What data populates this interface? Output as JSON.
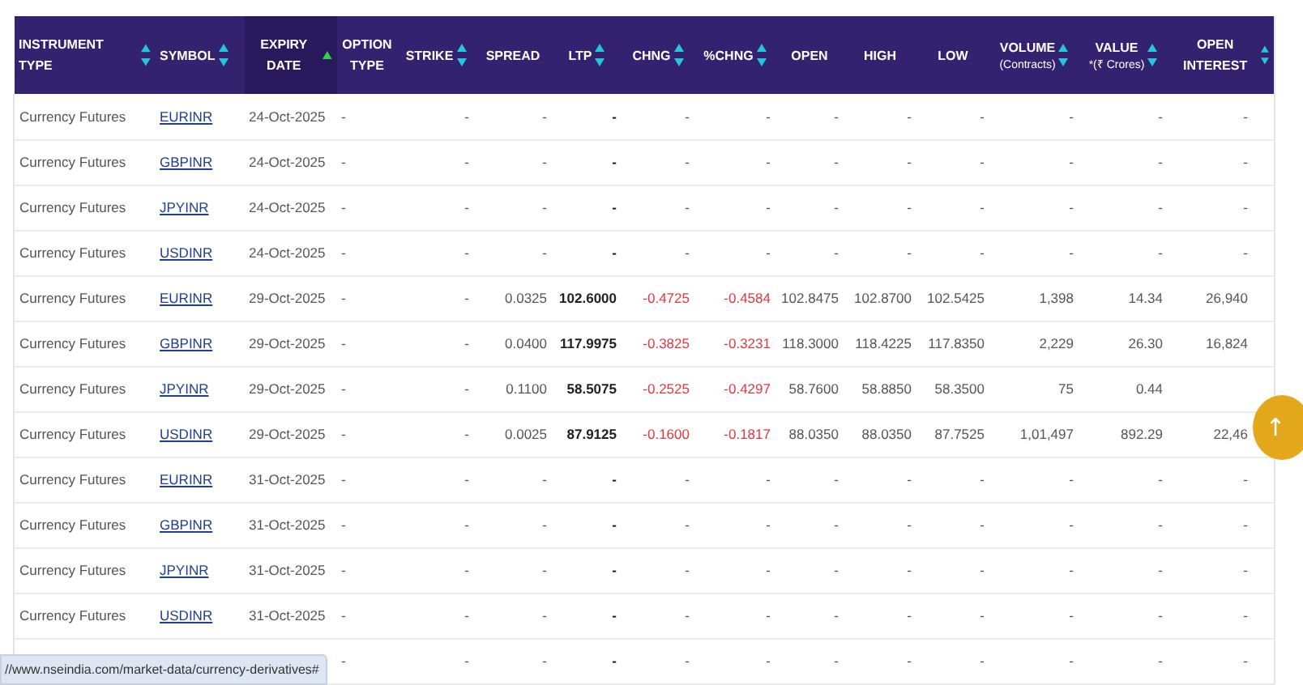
{
  "table": {
    "columns": [
      {
        "label": "INSTRUMENT TYPE",
        "sortable": true,
        "selected": false
      },
      {
        "label": "SYMBOL",
        "sortable": true,
        "selected": false
      },
      {
        "label": "EXPIRY DATE",
        "sortable": true,
        "selected": true
      },
      {
        "label": "OPTION TYPE",
        "sortable": false,
        "selected": false
      },
      {
        "label": "STRIKE",
        "sortable": true,
        "selected": false
      },
      {
        "label": "SPREAD",
        "sortable": false,
        "selected": false
      },
      {
        "label": "LTP",
        "sortable": true,
        "selected": false
      },
      {
        "label": "CHNG",
        "sortable": true,
        "selected": false
      },
      {
        "label": "%CHNG",
        "sortable": true,
        "selected": false
      },
      {
        "label": "OPEN",
        "sortable": false,
        "selected": false
      },
      {
        "label": "HIGH",
        "sortable": false,
        "selected": false
      },
      {
        "label": "LOW",
        "sortable": false,
        "selected": false
      },
      {
        "label": "VOLUME",
        "sublabel": "(Contracts)",
        "sortable": true,
        "selected": false
      },
      {
        "label": "VALUE",
        "sublabel": "*(₹ Crores)",
        "sortable": true,
        "selected": false
      },
      {
        "label": "OPEN INTEREST",
        "sortable": true,
        "selected": false
      }
    ],
    "rows": [
      {
        "cells": [
          "Currency Futures",
          "EURINR",
          "24-Oct-2025",
          "-",
          "-",
          "-",
          "-",
          "-",
          "-",
          "-",
          "-",
          "-",
          "-",
          "-",
          "-"
        ]
      },
      {
        "cells": [
          "Currency Futures",
          "GBPINR",
          "24-Oct-2025",
          "-",
          "-",
          "-",
          "-",
          "-",
          "-",
          "-",
          "-",
          "-",
          "-",
          "-",
          "-"
        ]
      },
      {
        "cells": [
          "Currency Futures",
          "JPYINR",
          "24-Oct-2025",
          "-",
          "-",
          "-",
          "-",
          "-",
          "-",
          "-",
          "-",
          "-",
          "-",
          "-",
          "-"
        ]
      },
      {
        "cells": [
          "Currency Futures",
          "USDINR",
          "24-Oct-2025",
          "-",
          "-",
          "-",
          "-",
          "-",
          "-",
          "-",
          "-",
          "-",
          "-",
          "-",
          "-"
        ]
      },
      {
        "cells": [
          "Currency Futures",
          "EURINR",
          "29-Oct-2025",
          "-",
          "-",
          "0.0325",
          "102.6000",
          "-0.4725",
          "-0.4584",
          "102.8475",
          "102.8700",
          "102.5425",
          "1,398",
          "14.34",
          "26,940"
        ],
        "negative_change": true
      },
      {
        "cells": [
          "Currency Futures",
          "GBPINR",
          "29-Oct-2025",
          "-",
          "-",
          "0.0400",
          "117.9975",
          "-0.3825",
          "-0.3231",
          "118.3000",
          "118.4225",
          "117.8350",
          "2,229",
          "26.30",
          "16,824"
        ],
        "negative_change": true
      },
      {
        "cells": [
          "Currency Futures",
          "JPYINR",
          "29-Oct-2025",
          "-",
          "-",
          "0.1100",
          "58.5075",
          "-0.2525",
          "-0.4297",
          "58.7600",
          "58.8850",
          "58.3500",
          "75",
          "0.44",
          null
        ],
        "negative_change": true
      },
      {
        "cells": [
          "Currency Futures",
          "USDINR",
          "29-Oct-2025",
          "-",
          "-",
          "0.0025",
          "87.9125",
          "-0.1600",
          "-0.1817",
          "88.0350",
          "88.0350",
          "87.7525",
          "1,01,497",
          "892.29",
          "22,46"
        ],
        "negative_change": true
      },
      {
        "cells": [
          "Currency Futures",
          "EURINR",
          "31-Oct-2025",
          "-",
          "-",
          "-",
          "-",
          "-",
          "-",
          "-",
          "-",
          "-",
          "-",
          "-",
          "-"
        ]
      },
      {
        "cells": [
          "Currency Futures",
          "GBPINR",
          "31-Oct-2025",
          "-",
          "-",
          "-",
          "-",
          "-",
          "-",
          "-",
          "-",
          "-",
          "-",
          "-",
          "-"
        ]
      },
      {
        "cells": [
          "Currency Futures",
          "JPYINR",
          "31-Oct-2025",
          "-",
          "-",
          "-",
          "-",
          "-",
          "-",
          "-",
          "-",
          "-",
          "-",
          "-",
          "-"
        ]
      },
      {
        "cells": [
          "Currency Futures",
          "USDINR",
          "31-Oct-2025",
          "-",
          "-",
          "-",
          "-",
          "-",
          "-",
          "-",
          "-",
          "-",
          "-",
          "-",
          "-"
        ]
      },
      {
        "cells": [
          null,
          null,
          null,
          "-",
          "-",
          "-",
          "-",
          "-",
          "-",
          "-",
          "-",
          "-",
          "-",
          "-",
          "-"
        ]
      }
    ]
  },
  "scroll_top_button": {
    "label": "↑"
  },
  "status_bar": {
    "url": "//www.nseindia.com/market-data/currency-derivatives#"
  }
}
